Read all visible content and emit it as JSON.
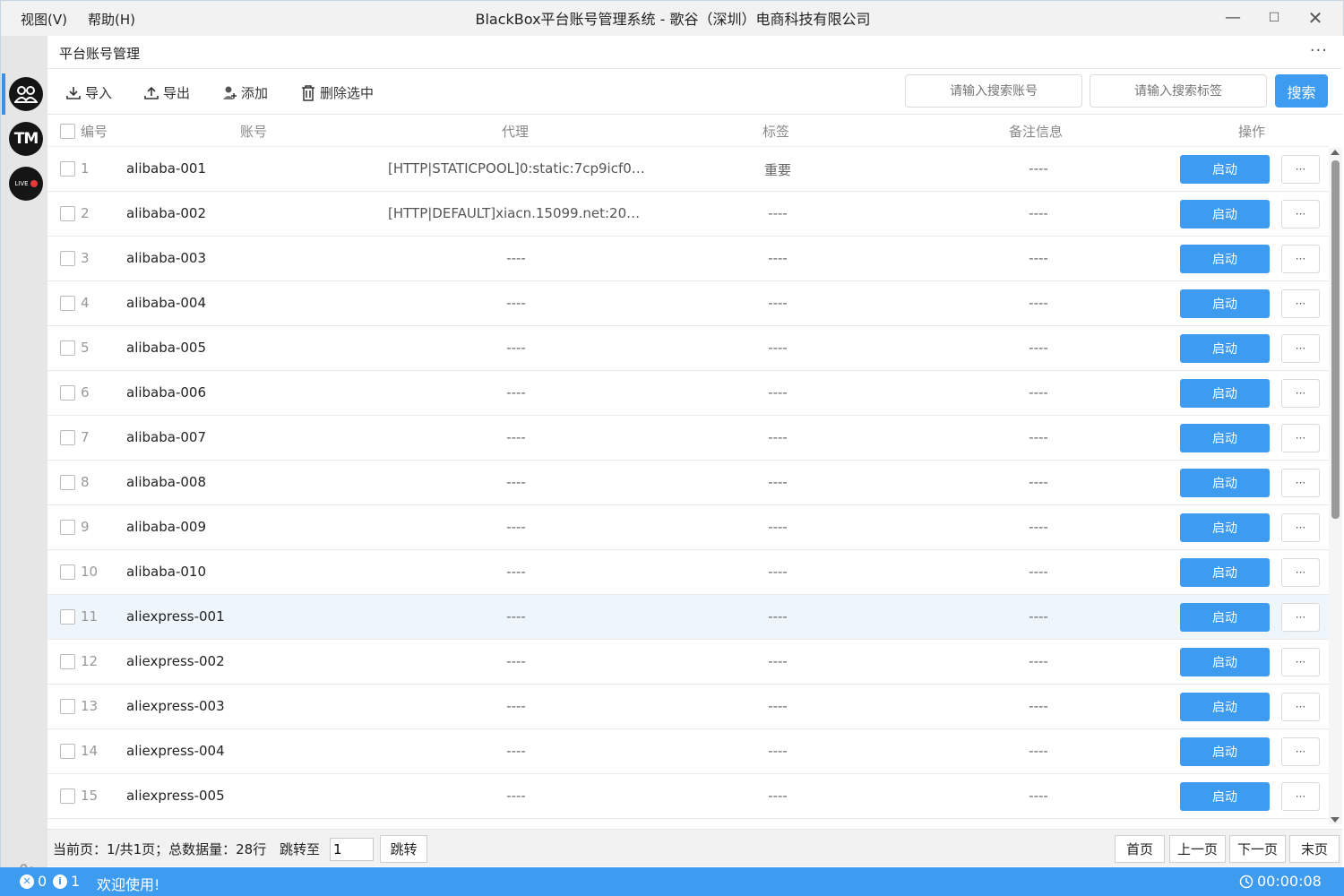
{
  "window": {
    "title": "BlackBox平台账号管理系统  -  歌谷（深圳）电商科技有限公司",
    "menus": [
      "视图(V)",
      "帮助(H)"
    ],
    "controls": {
      "minimize": "—",
      "maximize": "☐",
      "close": "✕"
    }
  },
  "sidebar": {
    "items": [
      {
        "icon": "accounts-icon",
        "active": true
      },
      {
        "icon": "tm-logo-icon",
        "label": "TM"
      },
      {
        "icon": "live-stream-icon",
        "label": "LIVE"
      }
    ],
    "settings_icon": "gear-icon"
  },
  "header": {
    "title": "平台账号管理",
    "more": "···"
  },
  "toolbar": {
    "import_label": "导入",
    "export_label": "导出",
    "add_label": "添加",
    "delete_label": "删除选中",
    "search_account_placeholder": "请输入搜索账号",
    "search_tag_placeholder": "请输入搜索标签",
    "search_label": "搜索"
  },
  "table": {
    "headers": {
      "num": "编号",
      "account": "账号",
      "proxy": "代理",
      "tag": "标签",
      "note": "备注信息",
      "action": "操作"
    },
    "start_label": "启动",
    "more_label": "···",
    "rows": [
      {
        "num": "1",
        "account": "alibaba-001",
        "proxy": "[HTTP|STATICPOOL]0:static:7cp9icf01 ...",
        "tag": "重要",
        "note": "----"
      },
      {
        "num": "2",
        "account": "alibaba-002",
        "proxy": "[HTTP|DEFAULT]xiacn.15099.net:2000...",
        "tag": "----",
        "note": "----"
      },
      {
        "num": "3",
        "account": "alibaba-003",
        "proxy": "----",
        "tag": "----",
        "note": "----"
      },
      {
        "num": "4",
        "account": "alibaba-004",
        "proxy": "----",
        "tag": "----",
        "note": "----"
      },
      {
        "num": "5",
        "account": "alibaba-005",
        "proxy": "----",
        "tag": "----",
        "note": "----"
      },
      {
        "num": "6",
        "account": "alibaba-006",
        "proxy": "----",
        "tag": "----",
        "note": "----"
      },
      {
        "num": "7",
        "account": "alibaba-007",
        "proxy": "----",
        "tag": "----",
        "note": "----"
      },
      {
        "num": "8",
        "account": "alibaba-008",
        "proxy": "----",
        "tag": "----",
        "note": "----"
      },
      {
        "num": "9",
        "account": "alibaba-009",
        "proxy": "----",
        "tag": "----",
        "note": "----"
      },
      {
        "num": "10",
        "account": "alibaba-010",
        "proxy": "----",
        "tag": "----",
        "note": "----"
      },
      {
        "num": "11",
        "account": "aliexpress-001",
        "proxy": "----",
        "tag": "----",
        "note": "----",
        "hover": true
      },
      {
        "num": "12",
        "account": "aliexpress-002",
        "proxy": "----",
        "tag": "----",
        "note": "----"
      },
      {
        "num": "13",
        "account": "aliexpress-003",
        "proxy": "----",
        "tag": "----",
        "note": "----"
      },
      {
        "num": "14",
        "account": "aliexpress-004",
        "proxy": "----",
        "tag": "----",
        "note": "----"
      },
      {
        "num": "15",
        "account": "aliexpress-005",
        "proxy": "----",
        "tag": "----",
        "note": "----"
      }
    ]
  },
  "pagination": {
    "info": "当前页：1/共1页；总数据量：28行",
    "jump_label": "跳转至",
    "jump_value": "1",
    "jump_button": "跳转",
    "first": "首页",
    "prev": "上一页",
    "next": "下一页",
    "last": "末页"
  },
  "statusbar": {
    "error_count": "0",
    "info_count": "1",
    "message": "欢迎使用!",
    "timer": "00:00:08"
  },
  "colors": {
    "accent": "#3d9bf0",
    "row_hover": "#eef6fc",
    "sidebar_bg": "#e6e6e6"
  }
}
